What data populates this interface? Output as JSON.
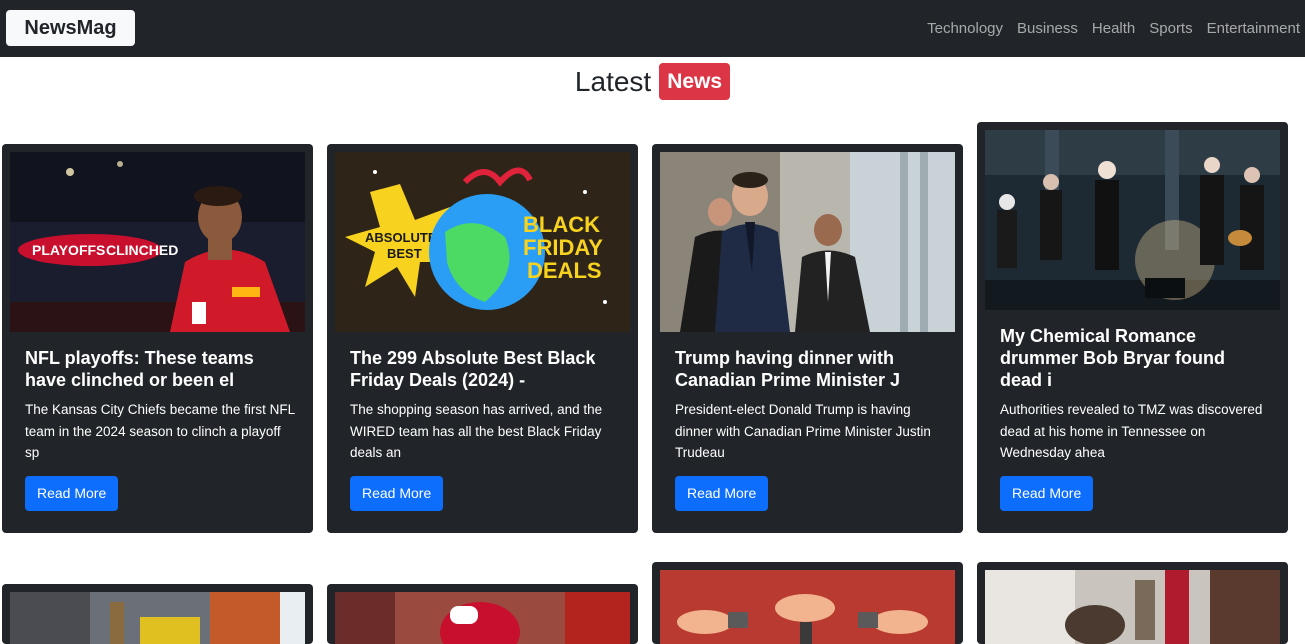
{
  "navbar": {
    "brand": "NewsMag",
    "links": [
      "Technology",
      "Business",
      "Health",
      "Sports",
      "Entertainment"
    ]
  },
  "heading": {
    "text": "Latest",
    "badge": "News"
  },
  "cards": [
    {
      "title": "NFL playoffs: These teams have clinched or been el",
      "description": "The Kansas City Chiefs became the first NFL team in the 2024 season to clinch a playoff sp",
      "button": "Read More",
      "image": "football-player-photo",
      "image_text": [
        "PLAYOFFS",
        "CLINCHED"
      ]
    },
    {
      "title": "The 299 Absolute Best Black Friday Deals (2024) -",
      "description": "The shopping season has arrived, and the WIRED team has all the best Black Friday deals an",
      "button": "Read More",
      "image": "black-friday-globe-illustration",
      "image_text": [
        "ABSOLUTE",
        "BEST",
        "BLACK",
        "FRIDAY",
        "DEALS"
      ]
    },
    {
      "title": "Trump having dinner with Canadian Prime Minister J",
      "description": "President-elect Donald Trump is having dinner with Canadian Prime Minister Justin Trudeau",
      "button": "Read More",
      "image": "politician-walking-photo"
    },
    {
      "title": "My Chemical Romance drummer Bob Bryar found dead i",
      "description": "Authorities revealed to TMZ was discovered dead at his home in Tennessee on Wednesday ahea",
      "button": "Read More",
      "image": "band-on-stage-photo"
    }
  ],
  "second_row_images": [
    "city-scene-photo",
    "football-helmet-photo",
    "hands-illustration",
    "parade-street-photo"
  ]
}
